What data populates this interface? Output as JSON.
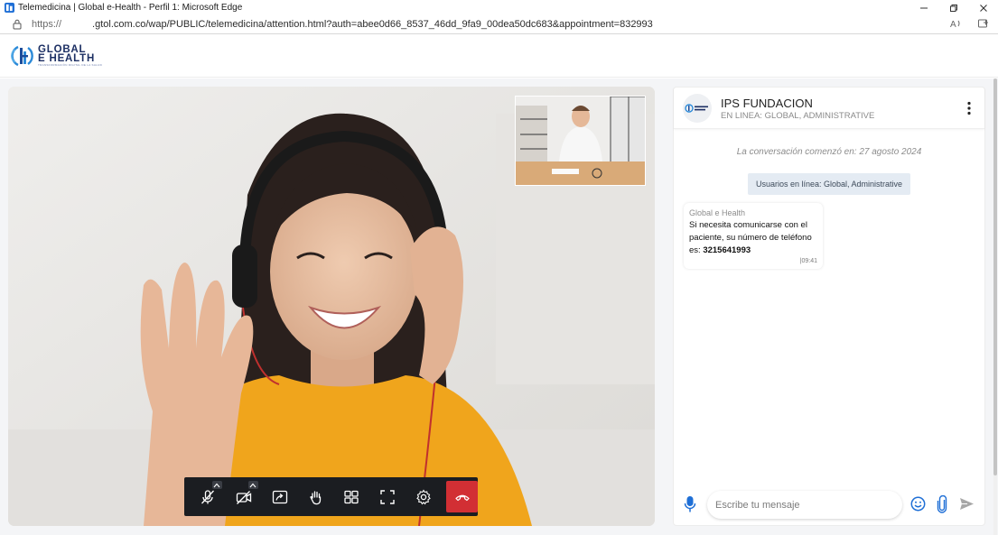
{
  "window": {
    "title": "Telemedicina | Global e-Health - Perfil 1: Microsoft Edge",
    "icon": "app-icon"
  },
  "address_bar": {
    "scheme": "https://",
    "host": ".gtol.com.co/wap/PUBLIC/telemedicina/attention.html?auth=abee0d66_8537_46dd_9fa9_00dea50dc683&appointment=832993"
  },
  "logo": {
    "line1": "GLOBAL",
    "line2": "E HEALTH",
    "tagline": "TRANSFORMACIÓN DIGITAL DE LA SALUD"
  },
  "call_controls": {
    "items": [
      "mic-muted-icon",
      "camera-off-icon",
      "screen-share-icon",
      "raise-hand-icon",
      "tile-view-icon",
      "fullscreen-icon",
      "settings-icon",
      "hangup-icon"
    ],
    "hangup_color": "#d22f34"
  },
  "chat": {
    "contact_name": "IPS FUNDACION",
    "contact_status": "EN LINEA: GLOBAL, ADMINISTRATIVE",
    "conversation_start": "La conversación comenzó en: 27 agosto 2024",
    "users_online": "Usuarios en línea: Global, Administrative",
    "message": {
      "sender": "Global e Health",
      "text": "Si necesita comunicarse con el paciente, su número de teléfono es:",
      "phone": "3215641993",
      "time": "09:41"
    },
    "input_placeholder": "Escribe tu mensaje"
  },
  "colors": {
    "accent": "#1f6fd6",
    "brand_dark": "#1c2f63",
    "hangup": "#d22f34",
    "toolbar_bg": "#1b1d21"
  }
}
